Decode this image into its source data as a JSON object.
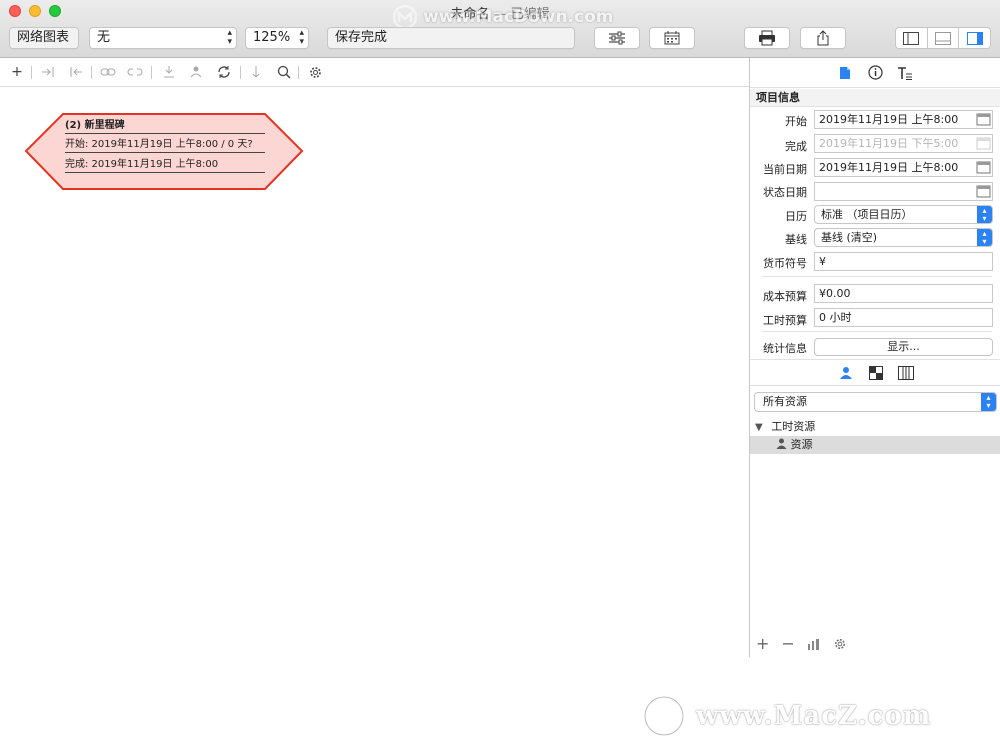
{
  "window": {
    "title": "未命名",
    "separator": "—",
    "state": "已编辑"
  },
  "toolbar": {
    "view_mode": "网络图表",
    "style_select": "无",
    "zoom": "125%",
    "status": "保存完成"
  },
  "milestone": {
    "title": "(2) 新里程碑",
    "start": "开始: 2019年11月19日 上午8:00 / 0 天?",
    "finish": "完成: 2019年11月19日 上午8:00",
    "fill_color": "#fcd6d3",
    "border_color": "#e53323"
  },
  "inspector": {
    "section_title": "项目信息",
    "rows": {
      "start_label": "开始",
      "start_value": "2019年11月19日 上午8:00",
      "finish_label": "完成",
      "finish_value": "2019年11月19日 下午5:00",
      "current_label": "当前日期",
      "current_value": "2019年11月19日 上午8:00",
      "status_label": "状态日期",
      "status_value": "",
      "calendar_label": "日历",
      "calendar_value": "标准 （项目日历）",
      "baseline_label": "基线",
      "baseline_value": "基线 (清空)",
      "currency_label": "货币符号",
      "currency_value": "¥",
      "cost_label": "成本预算",
      "cost_value": "¥0.00",
      "hours_label": "工时预算",
      "hours_value": "0 小时",
      "stats_label": "统计信息",
      "stats_button": "显示..."
    },
    "resources": {
      "filter": "所有资源",
      "group": "工时资源",
      "item": "资源"
    }
  },
  "watermark": {
    "top": "www.MacDown.com",
    "bottom": "www.MacZ.com"
  },
  "colors": {
    "accent": "#2a82f3"
  }
}
